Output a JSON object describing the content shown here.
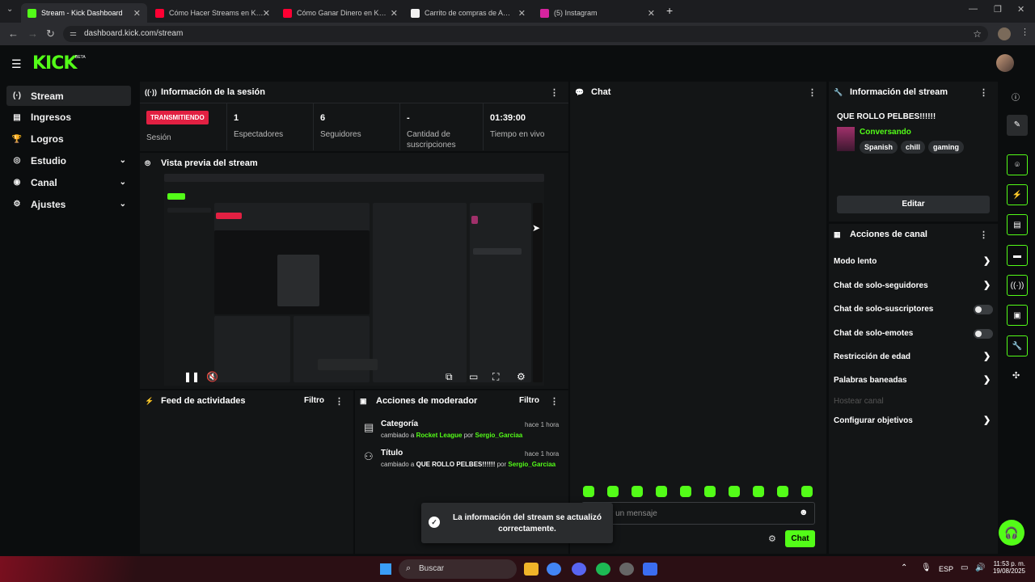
{
  "browser": {
    "tabs": [
      {
        "label": "Stream - Kick Dashboard",
        "active": true
      },
      {
        "label": "Cómo Hacer Streams en Kick (C",
        "active": false
      },
      {
        "label": "Cómo Ganar Dinero en Kick Ha",
        "active": false
      },
      {
        "label": "Carrito de compras de Amazon",
        "active": false
      },
      {
        "label": "(5) Instagram",
        "active": false
      }
    ],
    "url": "dashboard.kick.com/stream",
    "new_tab": "+"
  },
  "kick": {
    "logo": "KICK",
    "beta": "BETA",
    "sidebar": [
      {
        "label": "Stream",
        "icon": "stream-icon",
        "glyph": "(·)",
        "active": true,
        "chevron": false
      },
      {
        "label": "Ingresos",
        "icon": "income-icon",
        "glyph": "▤",
        "active": false,
        "chevron": false
      },
      {
        "label": "Logros",
        "icon": "trophy-icon",
        "glyph": "🏆",
        "active": false,
        "chevron": false
      },
      {
        "label": "Estudio",
        "icon": "studio-icon",
        "glyph": "◎",
        "active": false,
        "chevron": true
      },
      {
        "label": "Canal",
        "icon": "channel-icon",
        "glyph": "◉",
        "active": false,
        "chevron": true
      },
      {
        "label": "Ajustes",
        "icon": "settings-icon",
        "glyph": "⚙",
        "active": false,
        "chevron": true
      }
    ]
  },
  "session": {
    "title": "Información de la sesión",
    "badge": "TRANSMITIENDO",
    "session_label": "Sesión",
    "stats": [
      {
        "value": "1",
        "label": "Espectadores"
      },
      {
        "value": "6",
        "label": "Seguidores"
      },
      {
        "value": "-",
        "label": "Cantidad de suscripciones"
      },
      {
        "value": "01:39:00",
        "label": "Tiempo en vivo"
      }
    ]
  },
  "preview": {
    "title": "Vista previa del stream"
  },
  "activity": {
    "title": "Feed de actividades",
    "filter": "Filtro"
  },
  "moderator": {
    "title": "Acciones de moderador",
    "filter": "Filtro",
    "items": [
      {
        "title": "Categoría",
        "time": "hace 1 hora",
        "prefix": "cambiado a",
        "value": "Rocket League",
        "by": "por",
        "user": "Sergio_Garciaa"
      },
      {
        "title": "Título",
        "time": "hace 1 hora",
        "prefix": "cambiado a",
        "value": "QUE ROLLO PELBES!!!!!!",
        "by": "por",
        "user": "Sergio_Garciaa"
      }
    ]
  },
  "chat": {
    "title": "Chat",
    "placeholder": "Enviar un mensaje",
    "send": "Chat",
    "emote_count": 10
  },
  "toast": {
    "text": "La información del stream se actualizó correctamente."
  },
  "stream_info": {
    "title": "Información del stream",
    "stream_title": "QUE ROLLO PELBES!!!!!!",
    "category": "Conversando",
    "tags": [
      "Spanish",
      "chill",
      "gaming"
    ],
    "edit": "Editar"
  },
  "channel_actions": {
    "title": "Acciones de canal",
    "rows": [
      {
        "label": "Modo lento",
        "control": "arrow",
        "enabled": true
      },
      {
        "label": "Chat de solo-seguidores",
        "control": "arrow",
        "enabled": true
      },
      {
        "label": "Chat de solo-suscriptores",
        "control": "toggle",
        "enabled": true
      },
      {
        "label": "Chat de solo-emotes",
        "control": "toggle",
        "enabled": true
      },
      {
        "label": "Restricción de edad",
        "control": "arrow",
        "enabled": true
      },
      {
        "label": "Palabras baneadas",
        "control": "arrow",
        "enabled": true
      },
      {
        "label": "Hostear canal",
        "control": "none",
        "enabled": false
      },
      {
        "label": "Configurar objetivos",
        "control": "arrow",
        "enabled": true
      }
    ]
  },
  "taskbar": {
    "search": "Buscar",
    "lang": "ESP",
    "time": "11:53 p. m.",
    "date": "19/08/2025"
  },
  "colors": {
    "accent": "#53fc18",
    "live": "#e22042",
    "panel": "#131516",
    "bg": "#0b0d0e"
  }
}
